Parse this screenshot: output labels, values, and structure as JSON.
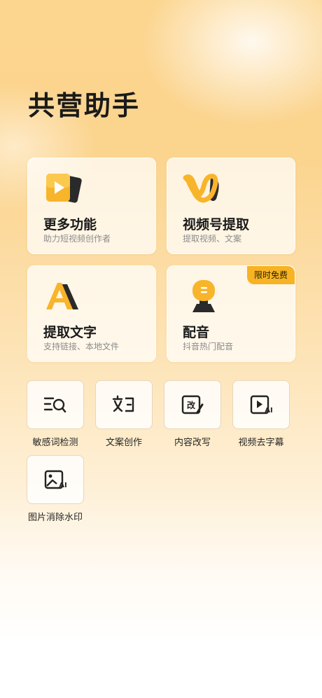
{
  "app": {
    "title": "共营助手"
  },
  "cards": [
    {
      "title": "更多功能",
      "subtitle": "助力短视频创作者",
      "icon": "play-card-icon"
    },
    {
      "title": "视频号提取",
      "subtitle": "提取视频、文案",
      "icon": "channels-logo-icon"
    },
    {
      "title": "提取文字",
      "subtitle": "支持链接、本地文件",
      "icon": "text-a-icon"
    },
    {
      "title": "配音",
      "subtitle": "抖音热门配音",
      "icon": "microphone-icon",
      "badge": "限时免费"
    }
  ],
  "tools": [
    {
      "label": "敏感词检测",
      "icon": "text-search-icon"
    },
    {
      "label": "文案创作",
      "icon": "text-edit-icon"
    },
    {
      "label": "内容改写",
      "icon": "rewrite-pen-icon"
    },
    {
      "label": "视频去字幕",
      "icon": "video-ai-icon"
    },
    {
      "label": "图片消除水印",
      "icon": "image-ai-icon"
    }
  ],
  "colors": {
    "accent": "#f7b324",
    "title": "#1a1a1a",
    "subtitle": "#8c8c8c"
  }
}
